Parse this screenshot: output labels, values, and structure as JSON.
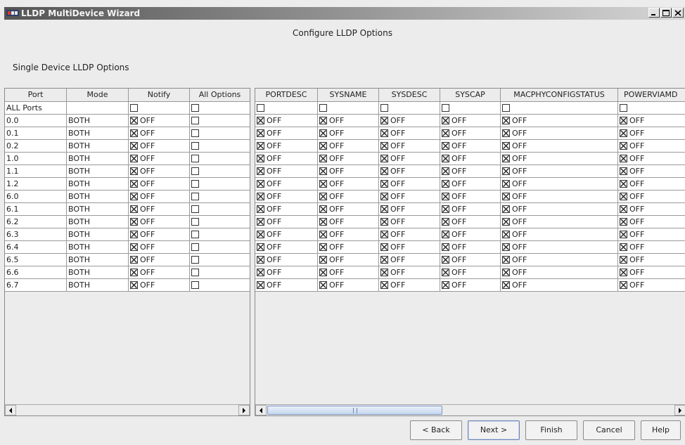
{
  "window": {
    "title": "LLDP MultiDevice Wizard"
  },
  "page": {
    "heading": "Configure LLDP Options",
    "subheading": "Single Device LLDP Options"
  },
  "left_table": {
    "columns": [
      "Port",
      "Mode",
      "Notify",
      "All Options"
    ],
    "all_ports_label": "ALL Ports",
    "rows": [
      {
        "port": "0.0",
        "mode": "BOTH",
        "notify": "OFF"
      },
      {
        "port": "0.1",
        "mode": "BOTH",
        "notify": "OFF"
      },
      {
        "port": "0.2",
        "mode": "BOTH",
        "notify": "OFF"
      },
      {
        "port": "1.0",
        "mode": "BOTH",
        "notify": "OFF"
      },
      {
        "port": "1.1",
        "mode": "BOTH",
        "notify": "OFF"
      },
      {
        "port": "1.2",
        "mode": "BOTH",
        "notify": "OFF"
      },
      {
        "port": "6.0",
        "mode": "BOTH",
        "notify": "OFF"
      },
      {
        "port": "6.1",
        "mode": "BOTH",
        "notify": "OFF"
      },
      {
        "port": "6.2",
        "mode": "BOTH",
        "notify": "OFF"
      },
      {
        "port": "6.3",
        "mode": "BOTH",
        "notify": "OFF"
      },
      {
        "port": "6.4",
        "mode": "BOTH",
        "notify": "OFF"
      },
      {
        "port": "6.5",
        "mode": "BOTH",
        "notify": "OFF"
      },
      {
        "port": "6.6",
        "mode": "BOTH",
        "notify": "OFF"
      },
      {
        "port": "6.7",
        "mode": "BOTH",
        "notify": "OFF"
      }
    ]
  },
  "right_table": {
    "columns": [
      "PORTDESC",
      "SYSNAME",
      "SYSDESC",
      "SYSCAP",
      "MACPHYCONFIGSTATUS",
      "POWERVIAMD"
    ],
    "cell_value": "OFF",
    "row_count": 14
  },
  "buttons": {
    "back": "< Back",
    "next": "Next >",
    "finish": "Finish",
    "cancel": "Cancel",
    "help": "Help"
  },
  "icons": {
    "app": "lldp-app-icon",
    "checked": "checkbox-checked-icon",
    "unchecked": "checkbox-unchecked-icon"
  }
}
